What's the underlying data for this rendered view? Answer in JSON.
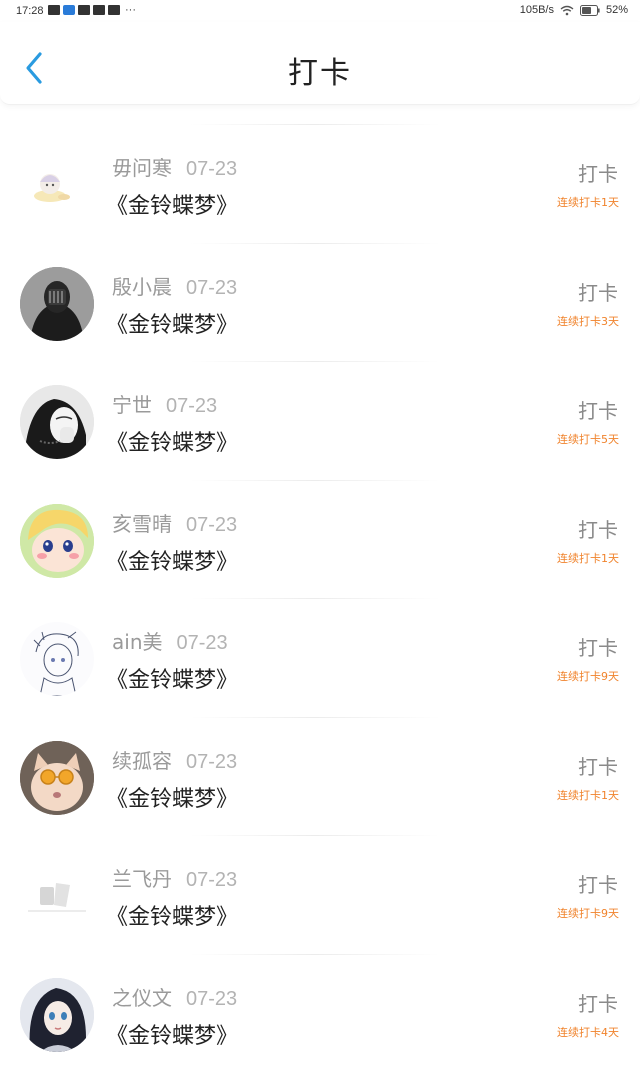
{
  "status_bar": {
    "time": "17:28",
    "more": "···",
    "network_speed": "105B/s",
    "battery": "52%"
  },
  "header": {
    "title": "打卡"
  },
  "accent_color": "#f0832c",
  "back_color": "#2a9be0",
  "entries": [
    {
      "name": "毋问寒",
      "date": "07-23",
      "book": "《金铃蝶梦》",
      "label": "打卡",
      "streak": "连续打卡1天",
      "avatar": "anime-character-avatar"
    },
    {
      "name": "殷小晨",
      "date": "07-23",
      "book": "《金铃蝶梦》",
      "label": "打卡",
      "streak": "连续打卡3天",
      "avatar": "masked-figure-avatar"
    },
    {
      "name": "宁世",
      "date": "07-23",
      "book": "《金铃蝶梦》",
      "label": "打卡",
      "streak": "连续打卡5天",
      "avatar": "girl-photo-avatar"
    },
    {
      "name": "亥雪晴",
      "date": "07-23",
      "book": "《金铃蝶梦》",
      "label": "打卡",
      "streak": "连续打卡1天",
      "avatar": "cartoon-face-avatar"
    },
    {
      "name": "ain美",
      "date": "07-23",
      "book": "《金铃蝶梦》",
      "label": "打卡",
      "streak": "连续打卡9天",
      "avatar": "sketch-character-avatar"
    },
    {
      "name": "续孤容",
      "date": "07-23",
      "book": "《金铃蝶梦》",
      "label": "打卡",
      "streak": "连续打卡1天",
      "avatar": "cat-with-glasses-avatar"
    },
    {
      "name": "兰飞丹",
      "date": "07-23",
      "book": "《金铃蝶梦》",
      "label": "打卡",
      "streak": "连续打卡9天",
      "avatar": "abstract-shape-avatar"
    },
    {
      "name": "之仪文",
      "date": "07-23",
      "book": "《金铃蝶梦》",
      "label": "打卡",
      "streak": "连续打卡4天",
      "avatar": "illustrated-girl-avatar"
    }
  ]
}
